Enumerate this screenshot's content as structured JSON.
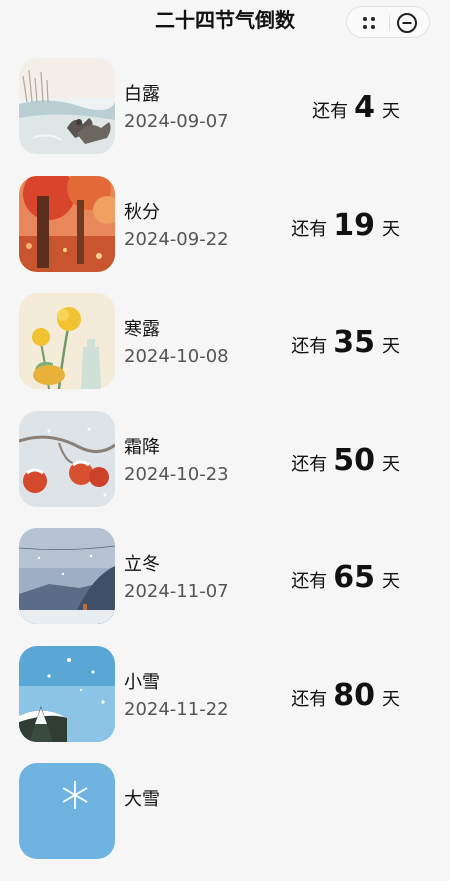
{
  "app": {
    "title": "二十四节气倒数"
  },
  "capsule": {
    "more_icon": "more-dots-icon",
    "close_icon": "close-circle-icon"
  },
  "labels": {
    "prefix": "还有",
    "suffix": "天"
  },
  "terms": [
    {
      "name": "白露",
      "date": "2024-09-07",
      "days": "4",
      "image": "geese-river"
    },
    {
      "name": "秋分",
      "date": "2024-09-22",
      "days": "19",
      "image": "autumn-forest"
    },
    {
      "name": "寒露",
      "date": "2024-10-08",
      "days": "35",
      "image": "chrysanthemum"
    },
    {
      "name": "霜降",
      "date": "2024-10-23",
      "days": "50",
      "image": "frosted-persimmons"
    },
    {
      "name": "立冬",
      "date": "2024-11-07",
      "days": "65",
      "image": "winter-mountain"
    },
    {
      "name": "小雪",
      "date": "2024-11-22",
      "days": "80",
      "image": "light-snow"
    },
    {
      "name": "大雪",
      "date": "",
      "days": "",
      "image": "snowflake"
    }
  ]
}
